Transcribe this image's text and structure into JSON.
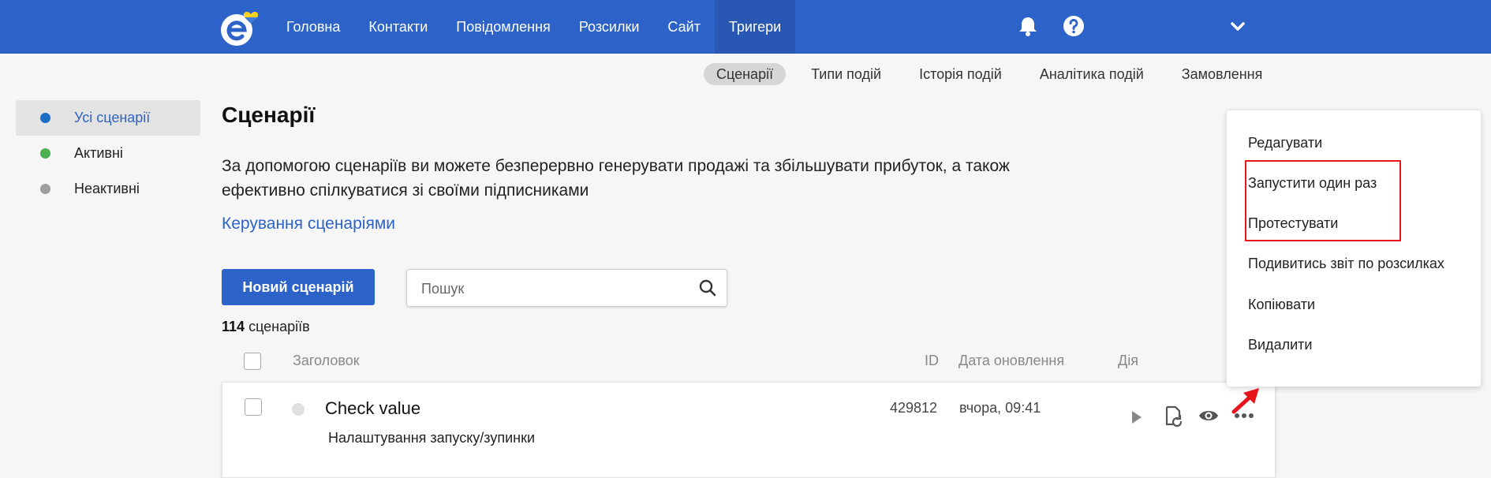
{
  "colors": {
    "brand": "#2d63c8",
    "active_dot": "#1a6fc4",
    "enabled_dot": "#4caf50",
    "disabled_dot": "#9e9e9e",
    "highlight": "#e8141c"
  },
  "nav": {
    "items": [
      "Головна",
      "Контакти",
      "Повідомлення",
      "Розсилки",
      "Сайт",
      "Тригери"
    ],
    "active": "Тригери"
  },
  "subnav": {
    "items": [
      "Сценарії",
      "Типи подій",
      "Історія подій",
      "Аналітика подій",
      "Замовлення"
    ],
    "active": "Сценарії"
  },
  "sidebar": {
    "items": [
      {
        "label": "Усі сценарії",
        "dot": "active_dot"
      },
      {
        "label": "Активні",
        "dot": "enabled_dot"
      },
      {
        "label": "Неактивні",
        "dot": "disabled_dot"
      }
    ]
  },
  "main": {
    "title": "Сценарії",
    "description": "За допомогою сценаріїв ви можете безперервно генерувати продажі та збільшувати прибуток, а також ефективно спілкуватися зі своїми підписниками",
    "manage_link": "Керування сценаріями",
    "new_button": "Новий сценарій",
    "search_placeholder": "Пошук",
    "count_number": "114",
    "count_label": "сценаріїв"
  },
  "table": {
    "columns": {
      "title": "Заголовок",
      "id": "ID",
      "updated": "Дата оновлення",
      "action": "Дія"
    },
    "rows": [
      {
        "title": "Check value",
        "subtitle": "Налаштування запуску/зупинки",
        "id": "429812",
        "updated": "вчора, 09:41"
      }
    ]
  },
  "menu": {
    "items": [
      "Редагувати",
      "Запустити один раз",
      "Протестувати",
      "Подивитись звіт по розсилках",
      "Копіювати",
      "Видалити"
    ]
  },
  "icons": [
    "logo-icon",
    "bell-icon",
    "help-icon",
    "chevron-down-icon",
    "search-icon",
    "play-icon",
    "restart-icon",
    "eye-icon",
    "more-icon",
    "arrow-icon"
  ]
}
